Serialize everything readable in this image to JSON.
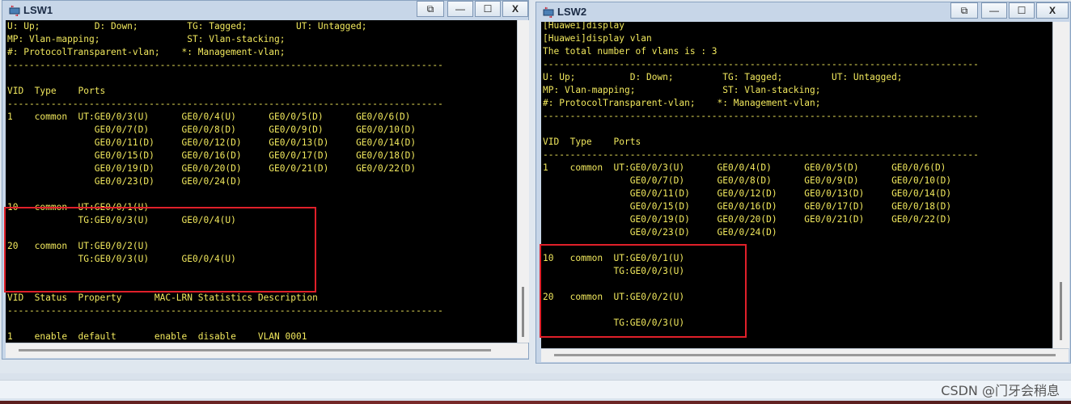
{
  "lsw1": {
    "title": "LSW1",
    "controls": {
      "restore": "⧉",
      "minimize": "—",
      "maximize": "☐",
      "close": "X"
    },
    "lines": [
      "U: Up;          D: Down;         TG: Tagged;         UT: Untagged;",
      "MP: Vlan-mapping;                ST: Vlan-stacking;",
      "#: ProtocolTransparent-vlan;    *: Management-vlan;",
      "--------------------------------------------------------------------------------",
      "",
      "VID  Type    Ports",
      "--------------------------------------------------------------------------------",
      "1    common  UT:GE0/0/3(U)      GE0/0/4(U)      GE0/0/5(D)      GE0/0/6(D)",
      "                GE0/0/7(D)      GE0/0/8(D)      GE0/0/9(D)      GE0/0/10(D)",
      "                GE0/0/11(D)     GE0/0/12(D)     GE0/0/13(D)     GE0/0/14(D)",
      "                GE0/0/15(D)     GE0/0/16(D)     GE0/0/17(D)     GE0/0/18(D)",
      "                GE0/0/19(D)     GE0/0/20(D)     GE0/0/21(D)     GE0/0/22(D)",
      "                GE0/0/23(D)     GE0/0/24(D)",
      "",
      "10   common  UT:GE0/0/1(U)",
      "             TG:GE0/0/3(U)      GE0/0/4(U)",
      "",
      "20   common  UT:GE0/0/2(U)",
      "             TG:GE0/0/3(U)      GE0/0/4(U)",
      "",
      "",
      "VID  Status  Property      MAC-LRN Statistics Description",
      "--------------------------------------------------------------------------------",
      "",
      "1    enable  default       enable  disable    VLAN 0001"
    ]
  },
  "lsw2": {
    "title": "LSW2",
    "controls": {
      "restore": "⧉",
      "minimize": "—",
      "maximize": "☐",
      "close": "X"
    },
    "lines": [
      "[Huawei]display",
      "[Huawei]display vlan",
      "The total number of vlans is : 3",
      "--------------------------------------------------------------------------------",
      "U: Up;          D: Down;         TG: Tagged;         UT: Untagged;",
      "MP: Vlan-mapping;                ST: Vlan-stacking;",
      "#: ProtocolTransparent-vlan;    *: Management-vlan;",
      "--------------------------------------------------------------------------------",
      "",
      "VID  Type    Ports",
      "--------------------------------------------------------------------------------",
      "1    common  UT:GE0/0/3(U)      GE0/0/4(D)      GE0/0/5(D)      GE0/0/6(D)",
      "                GE0/0/7(D)      GE0/0/8(D)      GE0/0/9(D)      GE0/0/10(D)",
      "                GE0/0/11(D)     GE0/0/12(D)     GE0/0/13(D)     GE0/0/14(D)",
      "                GE0/0/15(D)     GE0/0/16(D)     GE0/0/17(D)     GE0/0/18(D)",
      "                GE0/0/19(D)     GE0/0/20(D)     GE0/0/21(D)     GE0/0/22(D)",
      "                GE0/0/23(D)     GE0/0/24(D)",
      "",
      "10   common  UT:GE0/0/1(U)",
      "             TG:GE0/0/3(U)",
      "",
      "20   common  UT:GE0/0/2(U)",
      "",
      "             TG:GE0/0/3(U)"
    ]
  },
  "watermark": "CSDN @门牙会稍息"
}
